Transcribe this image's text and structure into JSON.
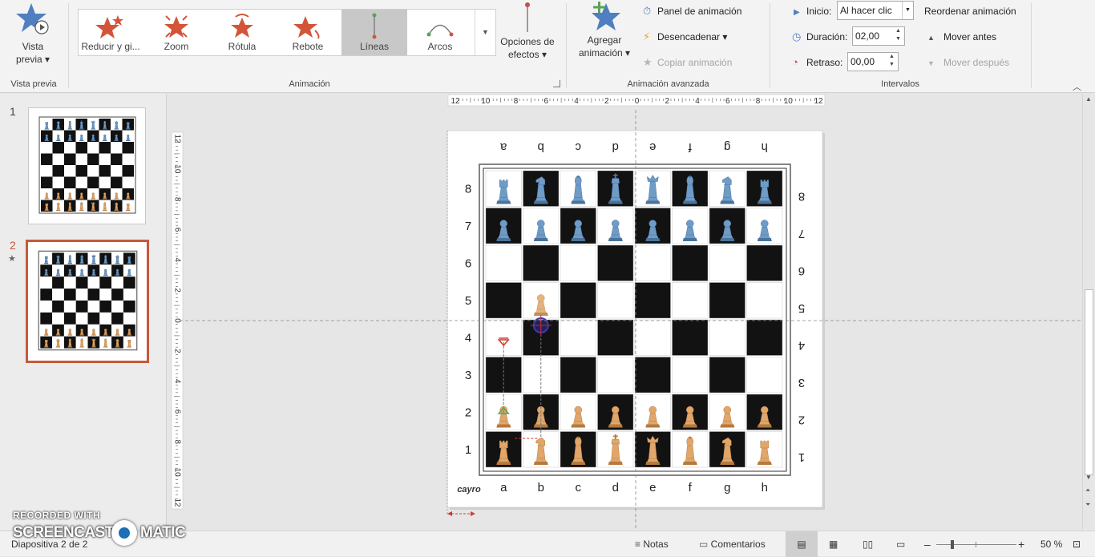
{
  "ribbon": {
    "preview": {
      "label_line1": "Vista",
      "label_line2": "previa ▾",
      "group": "Vista previa"
    },
    "animation_group": "Animación",
    "gallery": [
      {
        "label": "Reducir y gi...",
        "icon": "shrink-turn-icon",
        "selected": false
      },
      {
        "label": "Zoom",
        "icon": "zoom-star-icon",
        "selected": false
      },
      {
        "label": "Rótula",
        "icon": "swivel-star-icon",
        "selected": false
      },
      {
        "label": "Rebote",
        "icon": "bounce-star-icon",
        "selected": false
      },
      {
        "label": "Líneas",
        "icon": "lines-path-icon",
        "selected": true
      },
      {
        "label": "Arcos",
        "icon": "arcs-path-icon",
        "selected": false
      }
    ],
    "effect_options": {
      "line1": "Opciones de",
      "line2": "efectos ▾"
    },
    "advanced_group": "Animación avanzada",
    "add_animation": {
      "line1": "Agregar",
      "line2": "animación ▾"
    },
    "animation_panel": "Panel de animación",
    "trigger": "Desencadenar ▾",
    "copy_animation": "Copiar animación",
    "timing_group": "Intervalos",
    "start_label": "Inicio:",
    "start_value": "Al hacer clic",
    "duration_label": "Duración:",
    "duration_value": "02,00",
    "delay_label": "Retraso:",
    "delay_value": "00,00",
    "reorder_title": "Reordenar animación",
    "move_earlier": "Mover antes",
    "move_later": "Mover después"
  },
  "thumbnails": [
    {
      "number": "1",
      "star": "",
      "selected": false
    },
    {
      "number": "2",
      "star": "★",
      "selected": true
    }
  ],
  "board": {
    "files": [
      "a",
      "b",
      "c",
      "d",
      "e",
      "f",
      "g",
      "h"
    ],
    "ranks": [
      "1",
      "2",
      "3",
      "4",
      "5",
      "6",
      "7",
      "8"
    ],
    "logo": "cayro"
  },
  "ruler": {
    "h_labels": [
      "12",
      "10",
      "8",
      "6",
      "4",
      "2",
      "0",
      "2",
      "4",
      "6",
      "8",
      "10",
      "12"
    ],
    "v_labels": [
      "12",
      "10",
      "8",
      "6",
      "4",
      "2",
      "0",
      "2",
      "4",
      "6",
      "8",
      "10",
      "12"
    ]
  },
  "status": {
    "slide": "Diapositiva 2 de 2",
    "notes": "Notas",
    "comments": "Comentarios",
    "zoom": "50 %"
  },
  "watermark": {
    "line1": "RECORDED WITH",
    "line2a": "SCREENCAST",
    "line2b": "MATIC"
  },
  "colors": {
    "accent": "#c0504d",
    "selected_thumb_border": "#c55a3a",
    "blue_piece": "#6f9cc7",
    "tan_piece": "#e0a66a"
  }
}
